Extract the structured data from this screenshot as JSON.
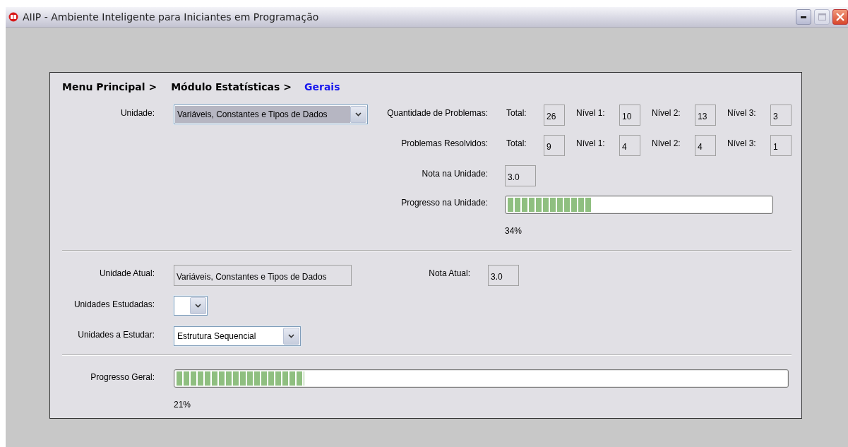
{
  "window": {
    "title": "AIIP - Ambiente Inteligente para Iniciantes em Programação"
  },
  "breadcrumb": [
    {
      "label": "Menu Principal >",
      "current": false
    },
    {
      "label": "Módulo Estatísticas >",
      "current": false
    },
    {
      "label": "Gerais",
      "current": true
    }
  ],
  "unit": {
    "label": "Unidade:",
    "value": "Variáveis, Constantes e Tipos de Dados"
  },
  "problem_rows": [
    {
      "label": "Quantidade de Problemas:",
      "cells": [
        {
          "label": "Total:",
          "value": "26"
        },
        {
          "label": "Nível 1:",
          "value": "10"
        },
        {
          "label": "Nível 2:",
          "value": "13"
        },
        {
          "label": "Nível 3:",
          "value": "3"
        }
      ]
    },
    {
      "label": "Problemas Resolvidos:",
      "cells": [
        {
          "label": "Total:",
          "value": "9"
        },
        {
          "label": "Nível 1:",
          "value": "4"
        },
        {
          "label": "Nível 2:",
          "value": "4"
        },
        {
          "label": "Nível 3:",
          "value": "1"
        }
      ]
    }
  ],
  "unit_grade": {
    "label": "Nota na Unidade:",
    "value": "3.0"
  },
  "unit_progress": {
    "label": "Progresso na Unidade:",
    "level": 0.32,
    "reading": "34%"
  },
  "current_unit": {
    "label": "Unidade Atual:",
    "value": "Variáveis, Constantes e Tipos de Dados"
  },
  "current_grade": {
    "label": "Nota Atual:",
    "value": "3.0"
  },
  "studied_units": {
    "label": "Unidades Estudadas:"
  },
  "units_to_study": {
    "label": "Unidades a Estudar:",
    "value": "Estrutura Sequencial"
  },
  "overall_progress": {
    "label": "Progresso Geral:",
    "level": 0.21,
    "reading": "21%"
  }
}
